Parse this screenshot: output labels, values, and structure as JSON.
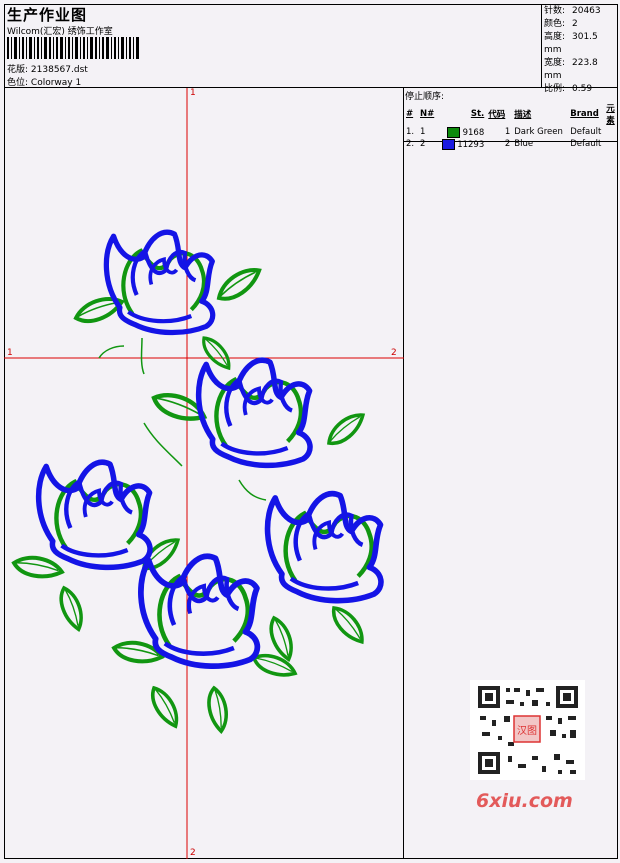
{
  "header": {
    "title": "生产作业图",
    "subtitle": "Wilcom(汇宏) 绣饰工作室",
    "design_label": "花版:",
    "design_value": "2138567.dst",
    "colorway_label": "色位:",
    "colorway_value": "Colorway 1"
  },
  "stats": [
    {
      "label": "针数:",
      "value": "20463"
    },
    {
      "label": "颜色:",
      "value": "2"
    },
    {
      "label": "高度:",
      "value": "301.5 mm"
    },
    {
      "label": "宽度:",
      "value": "223.8 mm"
    },
    {
      "label": "比例:",
      "value": "0.59"
    }
  ],
  "stop_sequence": {
    "title": "停止顺序:",
    "columns": [
      "#",
      "N#",
      "St.",
      "代码",
      "描述",
      "Brand",
      "元素"
    ],
    "rows": [
      {
        "idx": "1.",
        "n": "1",
        "color": "#0c8a0c",
        "st": "9168",
        "code": "1",
        "desc": "Dark Green",
        "brand": "Default"
      },
      {
        "idx": "2.",
        "n": "2",
        "color": "#1a1ae0",
        "st": "11293",
        "code": "2",
        "desc": "Blue",
        "brand": "Default"
      }
    ]
  },
  "axes": {
    "top": "1",
    "bottom": "2",
    "left": "1",
    "right": "2"
  },
  "watermark": {
    "text": "6xiu.com",
    "stamp": "汉图"
  },
  "colors": {
    "green": "#119611",
    "blue": "#1414e6",
    "axis": "#dd0000"
  }
}
